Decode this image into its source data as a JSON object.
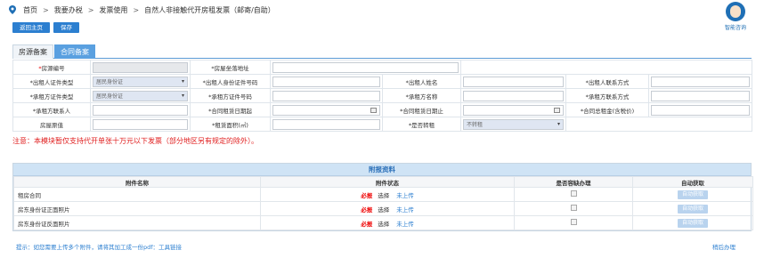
{
  "breadcrumb": {
    "items": [
      "首页",
      "我要办税",
      "发票使用",
      "自然人非接触代开房租发票（邮寄/自助）"
    ]
  },
  "helper": {
    "label": "智能咨询"
  },
  "toolbar": {
    "back_label": "返回主页",
    "save_label": "保存"
  },
  "tabs": [
    {
      "label": "房源备案",
      "active": false
    },
    {
      "label": "合同备案",
      "active": true
    }
  ],
  "form": {
    "house_no_label": "*房源编号",
    "house_address_label": "*房屋坐落地址",
    "lessor_id_type_label": "*出租人证件类型",
    "lessor_id_type_value": "居民身份证",
    "lessor_id_no_label": "*出租人身份证件号码",
    "lessor_name_label": "*出租人姓名",
    "lessor_contact_label": "*出租人联系方式",
    "tenant_id_type_label": "*承租方证件类型",
    "tenant_id_type_value": "居民身份证",
    "tenant_id_no_label": "*承租方证件号码",
    "tenant_name_label": "*承租方名称",
    "tenant_contact_label": "*承租方联系方式",
    "tenant_contact_person_label": "*承租方联系人",
    "contract_start_label": "*合同租赁日期起",
    "contract_end_label": "*合同租赁日期止",
    "contract_total_label": "*合同总租金(含税价)",
    "house_orig_value_label": "房屋原值",
    "rent_area_label": "*租赁面积(㎡)",
    "sublease_label": "*是否转租",
    "sublease_value": "不转租"
  },
  "note": "注意：本模块暂仅支持代开单张十万元以下发票（部分地区另有规定的除外）。",
  "attachments": {
    "title": "附报资料",
    "headers": [
      "附件名称",
      "附件状态",
      "是否容缺办理",
      "自动获取"
    ],
    "must_label": "必报",
    "choose_label": "选择",
    "status_label": "未上传",
    "auto_label": "自动获取",
    "rows": [
      {
        "name": "租房合同"
      },
      {
        "name": "房东身份证正面照片"
      },
      {
        "name": "房东身份证反面照片"
      }
    ]
  },
  "tip": {
    "text": "提示：如您需要上传多个附件，请将其加工成一份pdf：",
    "link": "工具链接"
  },
  "later": "稍后办理",
  "colors": {
    "accent": "#2c7fd0",
    "required": "#e02020",
    "panel_head": "#cfe3f5"
  }
}
